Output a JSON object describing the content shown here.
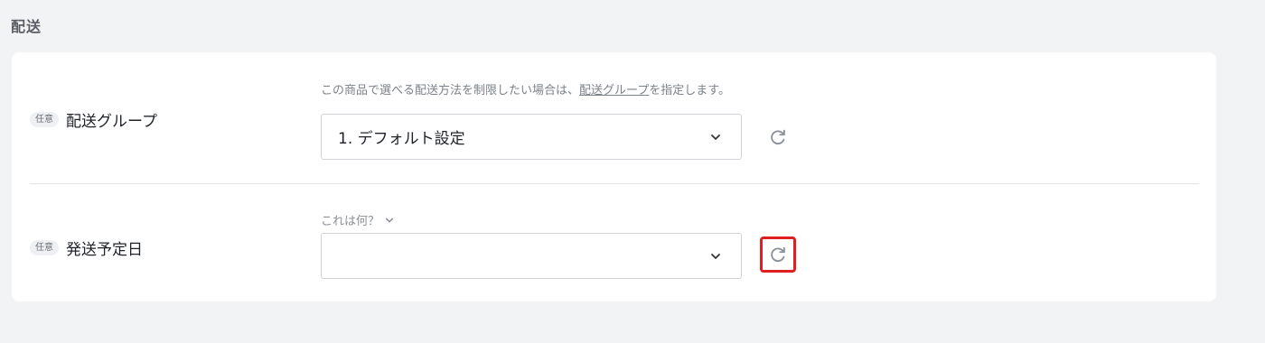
{
  "section": {
    "title": "配送"
  },
  "shipping_group": {
    "badge": "任意",
    "label": "配送グループ",
    "help_prefix": "この商品で選べる配送方法を制限したい場合は、",
    "help_link": "配送グループ",
    "help_suffix": "を指定します。",
    "selected_value": "1. デフォルト設定",
    "refresh_icon": "refresh-icon",
    "chevron_icon": "chevron-down-icon"
  },
  "ship_date": {
    "badge": "任意",
    "label": "発送予定日",
    "hint_toggle": "これは何？",
    "selected_value": "",
    "refresh_icon": "refresh-icon",
    "refresh_highlight_color": "#e02020"
  },
  "colors": {
    "background": "#f2f3f5",
    "card": "#ffffff",
    "highlight": "#e02020"
  }
}
